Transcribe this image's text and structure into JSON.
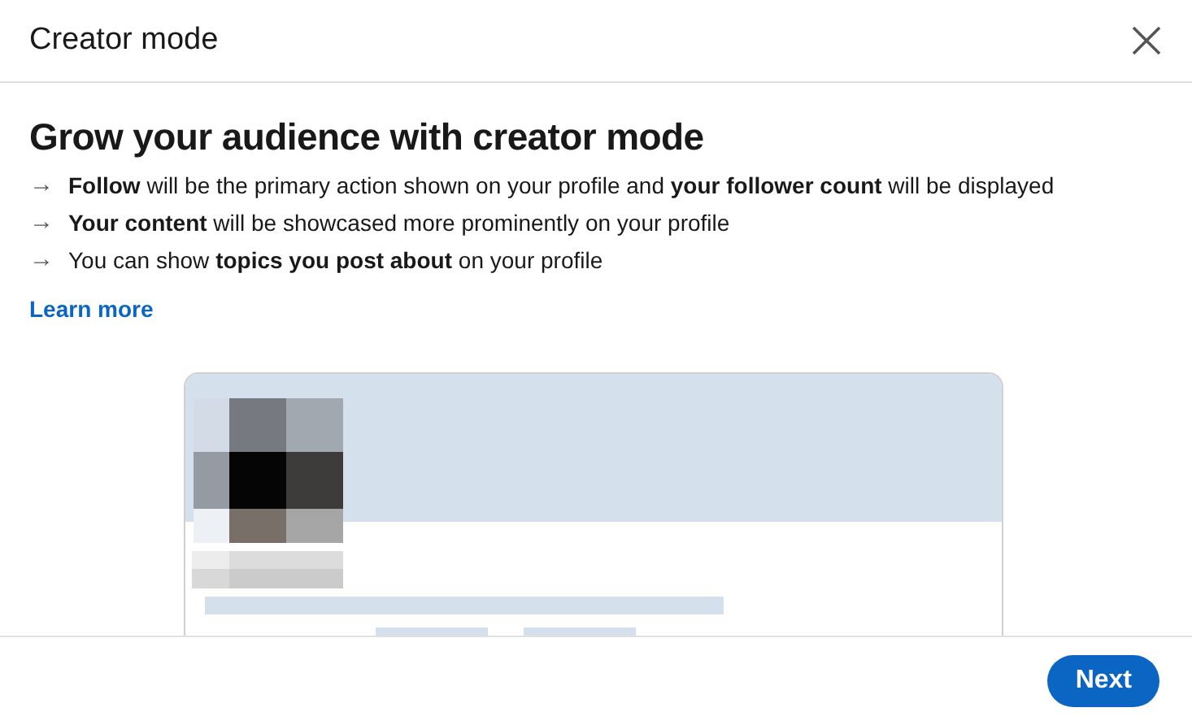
{
  "dialog": {
    "title": "Creator mode"
  },
  "heading": "Grow your audience with creator mode",
  "bullets": [
    {
      "icon": "→",
      "text": "**Follow** will be the primary action shown on your profile and **your follower count** will be displayed"
    },
    {
      "icon": "→",
      "text": "**Your content** will be showcased more prominently on your profile"
    },
    {
      "icon": "→",
      "text": "You can show **topics you post about** on your profile"
    }
  ],
  "learn_more": "Learn more",
  "buttons": [
    {
      "label": "Next",
      "kind": "primary"
    }
  ]
}
